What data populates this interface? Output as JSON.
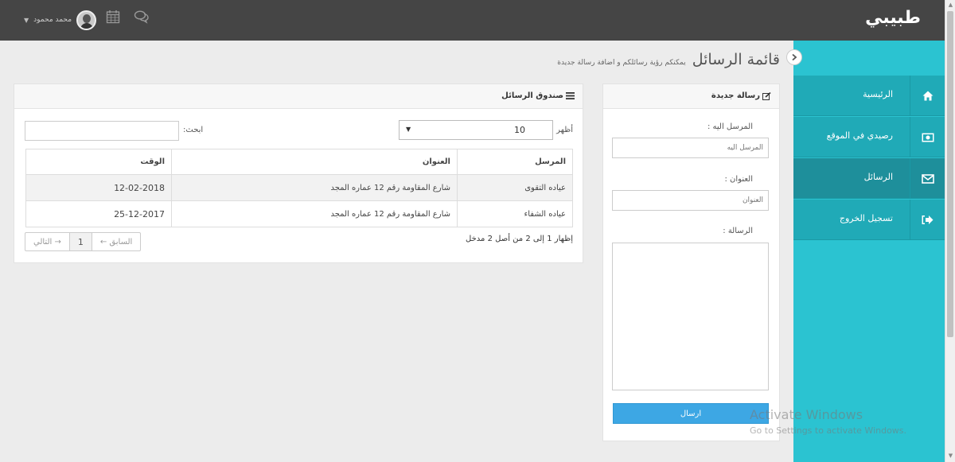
{
  "brand": "طبيبي",
  "topbar": {
    "user_name": "محمد محمود",
    "icons": [
      "calendar-icon",
      "chat-bubbles-icon",
      "caret-down-icon"
    ]
  },
  "sidebar": {
    "items": [
      {
        "label": "الرئيسية",
        "icon": "home-icon"
      },
      {
        "label": "رصيدي في الموقع",
        "icon": "money-icon"
      },
      {
        "label": "الرسائل",
        "icon": "envelope-icon"
      },
      {
        "label": "تسجيل الخروج",
        "icon": "logout-icon"
      }
    ],
    "active_index": 2
  },
  "page": {
    "title": "قائمة الرسائل",
    "subtitle": "يمكنكم رؤية رسائلكم و اضافة رسالة جديدة"
  },
  "new_message": {
    "title": "رسالة جديدة",
    "to_label": "المرسل اليه :",
    "to_placeholder": "المرسل اليه",
    "subject_label": "العنوان :",
    "subject_placeholder": "العنوان",
    "message_label": "الرسالة :",
    "send_label": "ارسال"
  },
  "inbox": {
    "title": "صندوق الرسائل",
    "show_label": "أظهر",
    "page_size": "10",
    "search_label": "ابحث:",
    "columns": [
      "المرسل",
      "العنوان",
      "الوقت"
    ],
    "rows": [
      {
        "sender": "عياده التقوى",
        "address": "شارع المقاومة رقم 12 عماره المجد",
        "time": "12-02-2018"
      },
      {
        "sender": "عياده الشفاء",
        "address": "شارع المقاومة رقم 12 عماره المجد",
        "time": "25-12-2017"
      }
    ],
    "info": "إظهار 1 إلى 2 من أصل 2 مدخل",
    "pager": {
      "prev": "← السابق",
      "current": "1",
      "next": "التالي →"
    }
  },
  "watermark": {
    "title": "Activate Windows",
    "subtitle": "Go to Settings to activate Windows."
  }
}
